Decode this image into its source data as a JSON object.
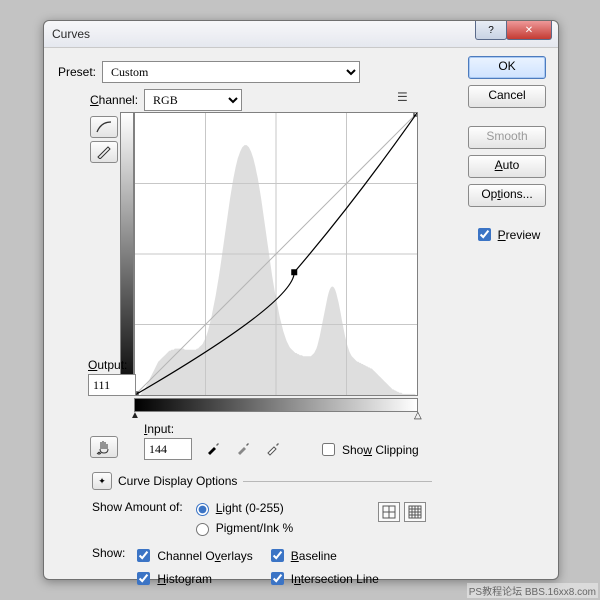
{
  "title": "Curves",
  "preset": {
    "label": "Preset:",
    "value": "Custom"
  },
  "channel": {
    "label": "Channel:",
    "value": "RGB"
  },
  "output": {
    "label": "Output:",
    "value": "111"
  },
  "input": {
    "label": "Input:",
    "value": "144"
  },
  "showClipping": "Show Clipping",
  "disclose": "Curve Display Options",
  "showAmount": {
    "label": "Show Amount of:",
    "light": "Light  (0-255)",
    "pigment": "Pigment/Ink %"
  },
  "show": {
    "label": "Show:",
    "channelOverlays": "Channel Overlays",
    "baseline": "Baseline",
    "histogram": "Histogram",
    "intersection": "Intersection Line"
  },
  "buttons": {
    "ok": "OK",
    "cancel": "Cancel",
    "smooth": "Smooth",
    "auto": "Auto",
    "options": "Options..."
  },
  "preview": "Preview",
  "watermark": "PS教程论坛 BBS.16xx8.com",
  "chart_data": {
    "type": "curve",
    "title": "Curves RGB",
    "xlabel": "Input",
    "ylabel": "Output",
    "xlim": [
      0,
      255
    ],
    "ylim": [
      0,
      255
    ],
    "baseline_diagonal": true,
    "control_points": [
      {
        "input": 0,
        "output": 0
      },
      {
        "input": 144,
        "output": 111
      },
      {
        "input": 255,
        "output": 255
      }
    ],
    "histogram_approx_0_255": [
      0,
      0,
      0,
      0,
      0,
      0,
      2,
      3,
      4,
      6,
      8,
      10,
      12,
      14,
      16,
      18,
      20,
      22,
      24,
      26,
      28,
      30,
      31,
      32,
      33,
      34,
      35,
      36,
      37,
      38,
      39,
      40,
      40,
      41,
      41,
      41,
      42,
      42,
      42,
      42,
      42,
      42,
      42,
      42,
      42,
      41,
      41,
      41,
      41,
      41,
      41,
      41,
      41,
      41,
      41,
      41,
      42,
      42,
      43,
      44,
      45,
      46,
      48,
      50,
      52,
      55,
      58,
      62,
      66,
      70,
      75,
      80,
      85,
      90,
      96,
      102,
      108,
      115,
      122,
      129,
      136,
      143,
      150,
      157,
      164,
      171,
      178,
      184,
      190,
      196,
      201,
      206,
      210,
      214,
      217,
      220,
      222,
      224,
      225,
      226,
      226,
      226,
      225,
      224,
      222,
      220,
      217,
      214,
      210,
      206,
      201,
      196,
      190,
      184,
      178,
      171,
      164,
      157,
      150,
      143,
      136,
      129,
      122,
      115,
      108,
      102,
      96,
      90,
      85,
      80,
      75,
      70,
      66,
      62,
      58,
      55,
      52,
      49,
      47,
      45,
      43,
      42,
      41,
      40,
      39,
      38,
      38,
      37,
      37,
      36,
      36,
      36,
      35,
      35,
      35,
      35,
      35,
      35,
      35,
      35,
      36,
      37,
      38,
      40,
      42,
      45,
      49,
      53,
      58,
      63,
      68,
      73,
      78,
      83,
      88,
      92,
      95,
      97,
      98,
      98,
      97,
      95,
      92,
      88,
      84,
      79,
      74,
      68,
      63,
      58,
      53,
      49,
      45,
      42,
      39,
      37,
      35,
      34,
      33,
      32,
      31,
      30,
      30,
      29,
      29,
      28,
      28,
      27,
      27,
      26,
      26,
      25,
      25,
      24,
      24,
      23,
      22,
      21,
      20,
      19,
      18,
      17,
      16,
      15,
      14,
      13,
      12,
      11,
      10,
      9,
      8,
      7,
      6,
      5,
      5,
      4,
      4,
      3,
      3,
      2,
      2,
      2,
      1,
      1,
      1,
      1,
      1,
      1,
      1,
      1,
      1,
      1,
      1,
      1,
      0,
      0
    ]
  }
}
